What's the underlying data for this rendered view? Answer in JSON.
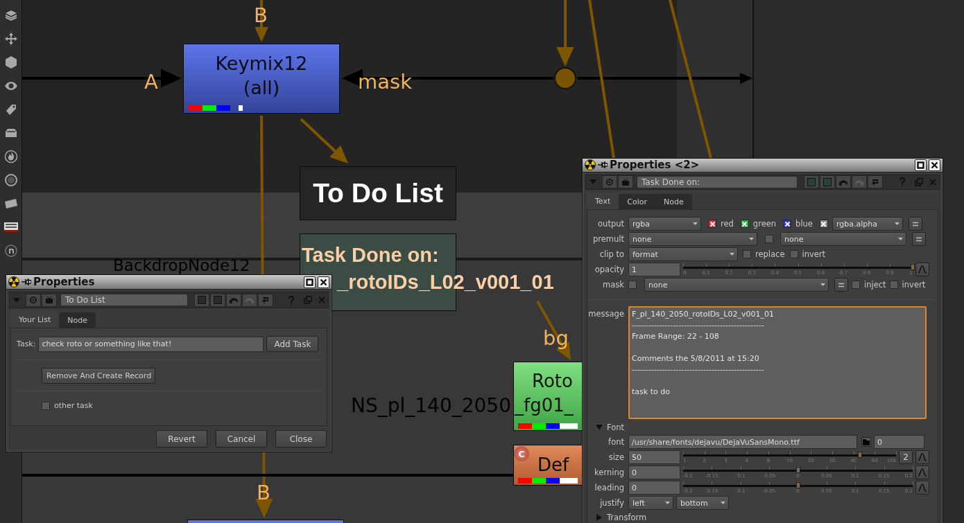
{
  "graph": {
    "backdrop_label": "BackdropNode12",
    "nodes": [
      {
        "kind": "keymix",
        "lines": [
          "Keymix12",
          "(all)"
        ]
      },
      {
        "kind": "sticky",
        "lines": [
          "To Do List"
        ]
      },
      {
        "kind": "text",
        "lines": [
          "Task Done on:",
          "_rotoIDs_L02_v001_01"
        ]
      },
      {
        "kind": "roto",
        "lines": [
          "Roto",
          "_fg01_"
        ]
      },
      {
        "kind": "defocus",
        "lines": [
          "Def"
        ],
        "badge": "C"
      },
      {
        "kind": "keymix_below"
      }
    ],
    "caption": "NS_pl_140_2050",
    "pipe_labels": [
      "B",
      "A",
      "mask",
      "bg",
      "B"
    ]
  },
  "properties_todo": {
    "title": "Properties",
    "node_name": "To Do List",
    "tabs": [
      {
        "label": "Your List",
        "selected": true
      },
      {
        "label": "Node",
        "selected": false
      }
    ],
    "task": {
      "label": "Task:",
      "value": "check roto or something like that!",
      "button": "Add Task"
    },
    "record_button": "Remove And Create Record",
    "option": {
      "label": "other task",
      "checked": false
    },
    "buttons": [
      "Revert",
      "Cancel",
      "Close"
    ]
  },
  "properties_text": {
    "title": "Properties <2>",
    "node_name": "Task Done on:",
    "tabs": [
      {
        "label": "Text",
        "selected": true
      },
      {
        "label": "Color",
        "selected": false
      },
      {
        "label": "Node",
        "selected": false
      }
    ],
    "knobs": [
      {
        "kind": "output",
        "label": "output",
        "value": "rgba",
        "channels": [
          {
            "label": "red",
            "checked": true,
            "color": "#c8303c"
          },
          {
            "label": "green",
            "checked": true,
            "color": "#2fa83c"
          },
          {
            "label": "blue",
            "checked": true,
            "color": "#3034b8"
          },
          {
            "checked": true,
            "color": "#8a8a8a"
          }
        ],
        "value2": "rgba.alpha"
      },
      {
        "kind": "premult",
        "label": "premult",
        "value": "none",
        "checked": false,
        "value2": "none"
      },
      {
        "kind": "clip",
        "label": "clip to",
        "value": "format",
        "options": [
          {
            "label": "replace",
            "checked": false
          },
          {
            "label": "invert",
            "checked": false
          }
        ]
      },
      {
        "kind": "slider",
        "label": "opacity",
        "value": "1",
        "level": 1,
        "ticks": [
          "0",
          "0.1",
          "0.2",
          "0.3",
          "0.4",
          "0.5",
          "0.6",
          "0.7",
          "0.8",
          "0.9",
          "1"
        ]
      },
      {
        "kind": "mask",
        "label": "mask",
        "checked": false,
        "value": "none",
        "options": [
          {
            "label": "inject",
            "checked": false
          },
          {
            "label": "invert",
            "checked": false
          }
        ]
      }
    ],
    "message": {
      "label": "message",
      "value": "F_pl_140_2050_rotoIDs_L02_v001_01\n------------------------------------------------\nFrame Range: 22 - 108\n\nComments the 5/8/2011 at 15:20\n------------------------------------------------\n\ntask to do"
    },
    "groups": [
      {
        "label": "Font",
        "expanded": true,
        "knobs": [
          {
            "kind": "file",
            "label": "font",
            "value": "/usr/share/fonts/dejavu/DejaVuSansMono.ttf",
            "value2": "0"
          },
          {
            "kind": "slider",
            "label": "size",
            "value": "50",
            "level": 0.83,
            "ticks": [
              "1",
              "2",
              "3",
              "4",
              "6",
              "10",
              "20",
              "30",
              "40",
              "60",
              "100"
            ],
            "step": "2"
          },
          {
            "kind": "slider",
            "label": "kerning",
            "value": "0",
            "level": 0.5,
            "ticks": [
              "-0.2",
              "-0.15",
              "-0.1",
              "-0.05",
              "0",
              "0.05",
              "0.1",
              "0.15",
              "0.2"
            ]
          },
          {
            "kind": "slider",
            "label": "leading",
            "value": "0",
            "level": 0.5,
            "ticks": [
              "-0.2",
              "-0.15",
              "-0.1",
              "-0.05",
              "0",
              "0.05",
              "0.1",
              "0.15",
              "0.2"
            ]
          },
          {
            "kind": "justify",
            "label": "justify",
            "values": [
              "left",
              "bottom"
            ]
          }
        ]
      },
      {
        "label": "Transform",
        "expanded": false
      }
    ]
  }
}
